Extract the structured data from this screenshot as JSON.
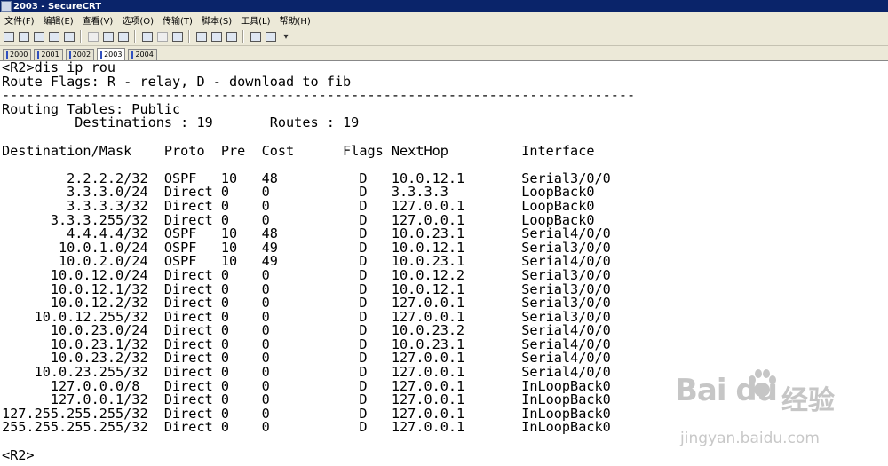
{
  "window": {
    "title": "2003 - SecureCRT"
  },
  "menu": [
    {
      "label": "文件(F)"
    },
    {
      "label": "编辑(E)"
    },
    {
      "label": "查看(V)"
    },
    {
      "label": "选项(O)"
    },
    {
      "label": "传输(T)"
    },
    {
      "label": "脚本(S)"
    },
    {
      "label": "工具(L)"
    },
    {
      "label": "帮助(H)"
    }
  ],
  "tabs": [
    {
      "label": "2000"
    },
    {
      "label": "2001"
    },
    {
      "label": "2002"
    },
    {
      "label": "2003"
    },
    {
      "label": "2004"
    }
  ],
  "terminal": {
    "text": "<R2>dis ip rou\nRoute Flags: R - relay, D - download to fib\n------------------------------------------------------------------------------\nRouting Tables: Public\n         Destinations : 19       Routes : 19\n\nDestination/Mask    Proto  Pre  Cost      Flags NextHop         Interface\n\n        2.2.2.2/32  OSPF   10   48          D   10.0.12.1       Serial3/0/0\n        3.3.3.0/24  Direct 0    0           D   3.3.3.3         LoopBack0\n        3.3.3.3/32  Direct 0    0           D   127.0.0.1       LoopBack0\n      3.3.3.255/32  Direct 0    0           D   127.0.0.1       LoopBack0\n        4.4.4.4/32  OSPF   10   48          D   10.0.23.1       Serial4/0/0\n       10.0.1.0/24  OSPF   10   49          D   10.0.12.1       Serial3/0/0\n       10.0.2.0/24  OSPF   10   49          D   10.0.23.1       Serial4/0/0\n      10.0.12.0/24  Direct 0    0           D   10.0.12.2       Serial3/0/0\n      10.0.12.1/32  Direct 0    0           D   10.0.12.1       Serial3/0/0\n      10.0.12.2/32  Direct 0    0           D   127.0.0.1       Serial3/0/0\n    10.0.12.255/32  Direct 0    0           D   127.0.0.1       Serial3/0/0\n      10.0.23.0/24  Direct 0    0           D   10.0.23.2       Serial4/0/0\n      10.0.23.1/32  Direct 0    0           D   10.0.23.1       Serial4/0/0\n      10.0.23.2/32  Direct 0    0           D   127.0.0.1       Serial4/0/0\n    10.0.23.255/32  Direct 0    0           D   127.0.0.1       Serial4/0/0\n      127.0.0.0/8   Direct 0    0           D   127.0.0.1       InLoopBack0\n      127.0.0.1/32  Direct 0    0           D   127.0.0.1       InLoopBack0\n127.255.255.255/32  Direct 0    0           D   127.0.0.1       InLoopBack0\n255.255.255.255/32  Direct 0    0           D   127.0.0.1       InLoopBack0\n\n<R2>"
  },
  "watermark": {
    "logo": "Bai  du",
    "cn": "经验",
    "url": "jingyan.baidu.com"
  }
}
